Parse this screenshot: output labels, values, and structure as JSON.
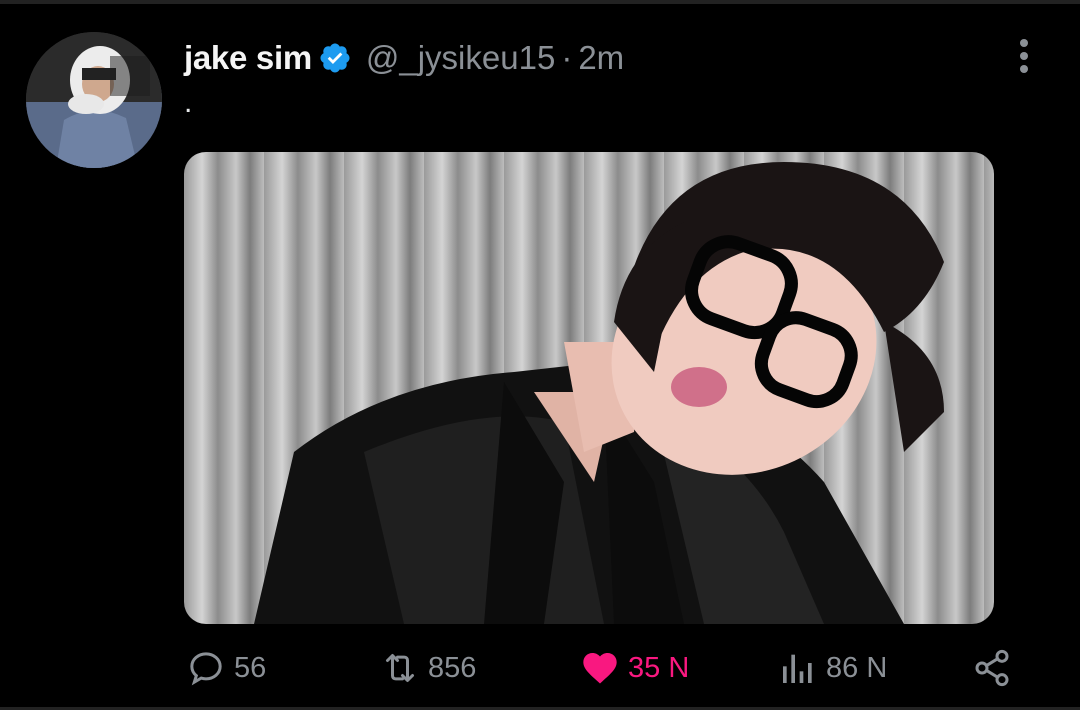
{
  "tweet": {
    "display_name": "jake sim",
    "verified": true,
    "handle": "@_jysikeu15",
    "separator": "·",
    "timestamp": "2m",
    "text": "."
  },
  "media": {
    "kind": "photo"
  },
  "actions": {
    "replies": "56",
    "retweets": "856",
    "likes": "35 N",
    "views": "86 N"
  },
  "colors": {
    "background": "#000000",
    "muted": "#8b9096",
    "verified": "#1d9bf0",
    "like": "#f91880"
  },
  "icons": [
    "verified-badge-icon",
    "more-vertical-icon",
    "reply-icon",
    "retweet-icon",
    "heart-icon",
    "views-chart-icon",
    "share-icon"
  ]
}
